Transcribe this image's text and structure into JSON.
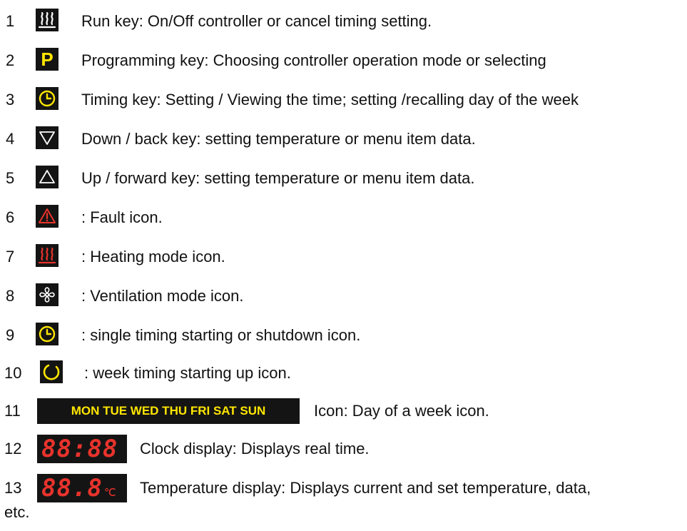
{
  "items": [
    {
      "num": "1",
      "icon": "heat-key-icon",
      "text": "Run key: On/Off controller or cancel timing setting."
    },
    {
      "num": "2",
      "icon": "p-key-icon",
      "symbol": "P",
      "text": "Programming key: Choosing controller operation mode or selecting"
    },
    {
      "num": "3",
      "icon": "clock-key-icon",
      "text": "Timing key: Setting / Viewing the time; setting /recalling day of the week"
    },
    {
      "num": "4",
      "icon": "down-triangle-icon",
      "text": "Down / back key: setting temperature or menu item data."
    },
    {
      "num": "5",
      "icon": "up-triangle-icon",
      "text": "Up / forward key: setting temperature or menu item data."
    },
    {
      "num": "6",
      "icon": "fault-warning-icon",
      "text": ": Fault icon."
    },
    {
      "num": "7",
      "icon": "heating-mode-icon",
      "text": ": Heating mode icon."
    },
    {
      "num": "8",
      "icon": "fan-icon",
      "text": ": Ventilation mode icon."
    },
    {
      "num": "9",
      "icon": "single-timer-icon",
      "text": ": single timing starting or shutdown icon."
    },
    {
      "num": "10",
      "icon": "week-timer-icon",
      "text": ": week timing starting up icon."
    },
    {
      "num": "11",
      "days": "MON TUE WED THU FRI SAT SUN",
      "text": "Icon: Day of a week icon."
    },
    {
      "num": "12",
      "display": "88:88",
      "text": "Clock display: Displays real time."
    },
    {
      "num": "13",
      "display": "88.8",
      "unit": "℃",
      "text": "Temperature display: Displays current and set temperature, data,"
    }
  ],
  "tail_text": "etc.",
  "colors": {
    "key_bg": "#141414",
    "yellow": "#ffe600",
    "red": "#e8332c",
    "white": "#ffffff"
  }
}
